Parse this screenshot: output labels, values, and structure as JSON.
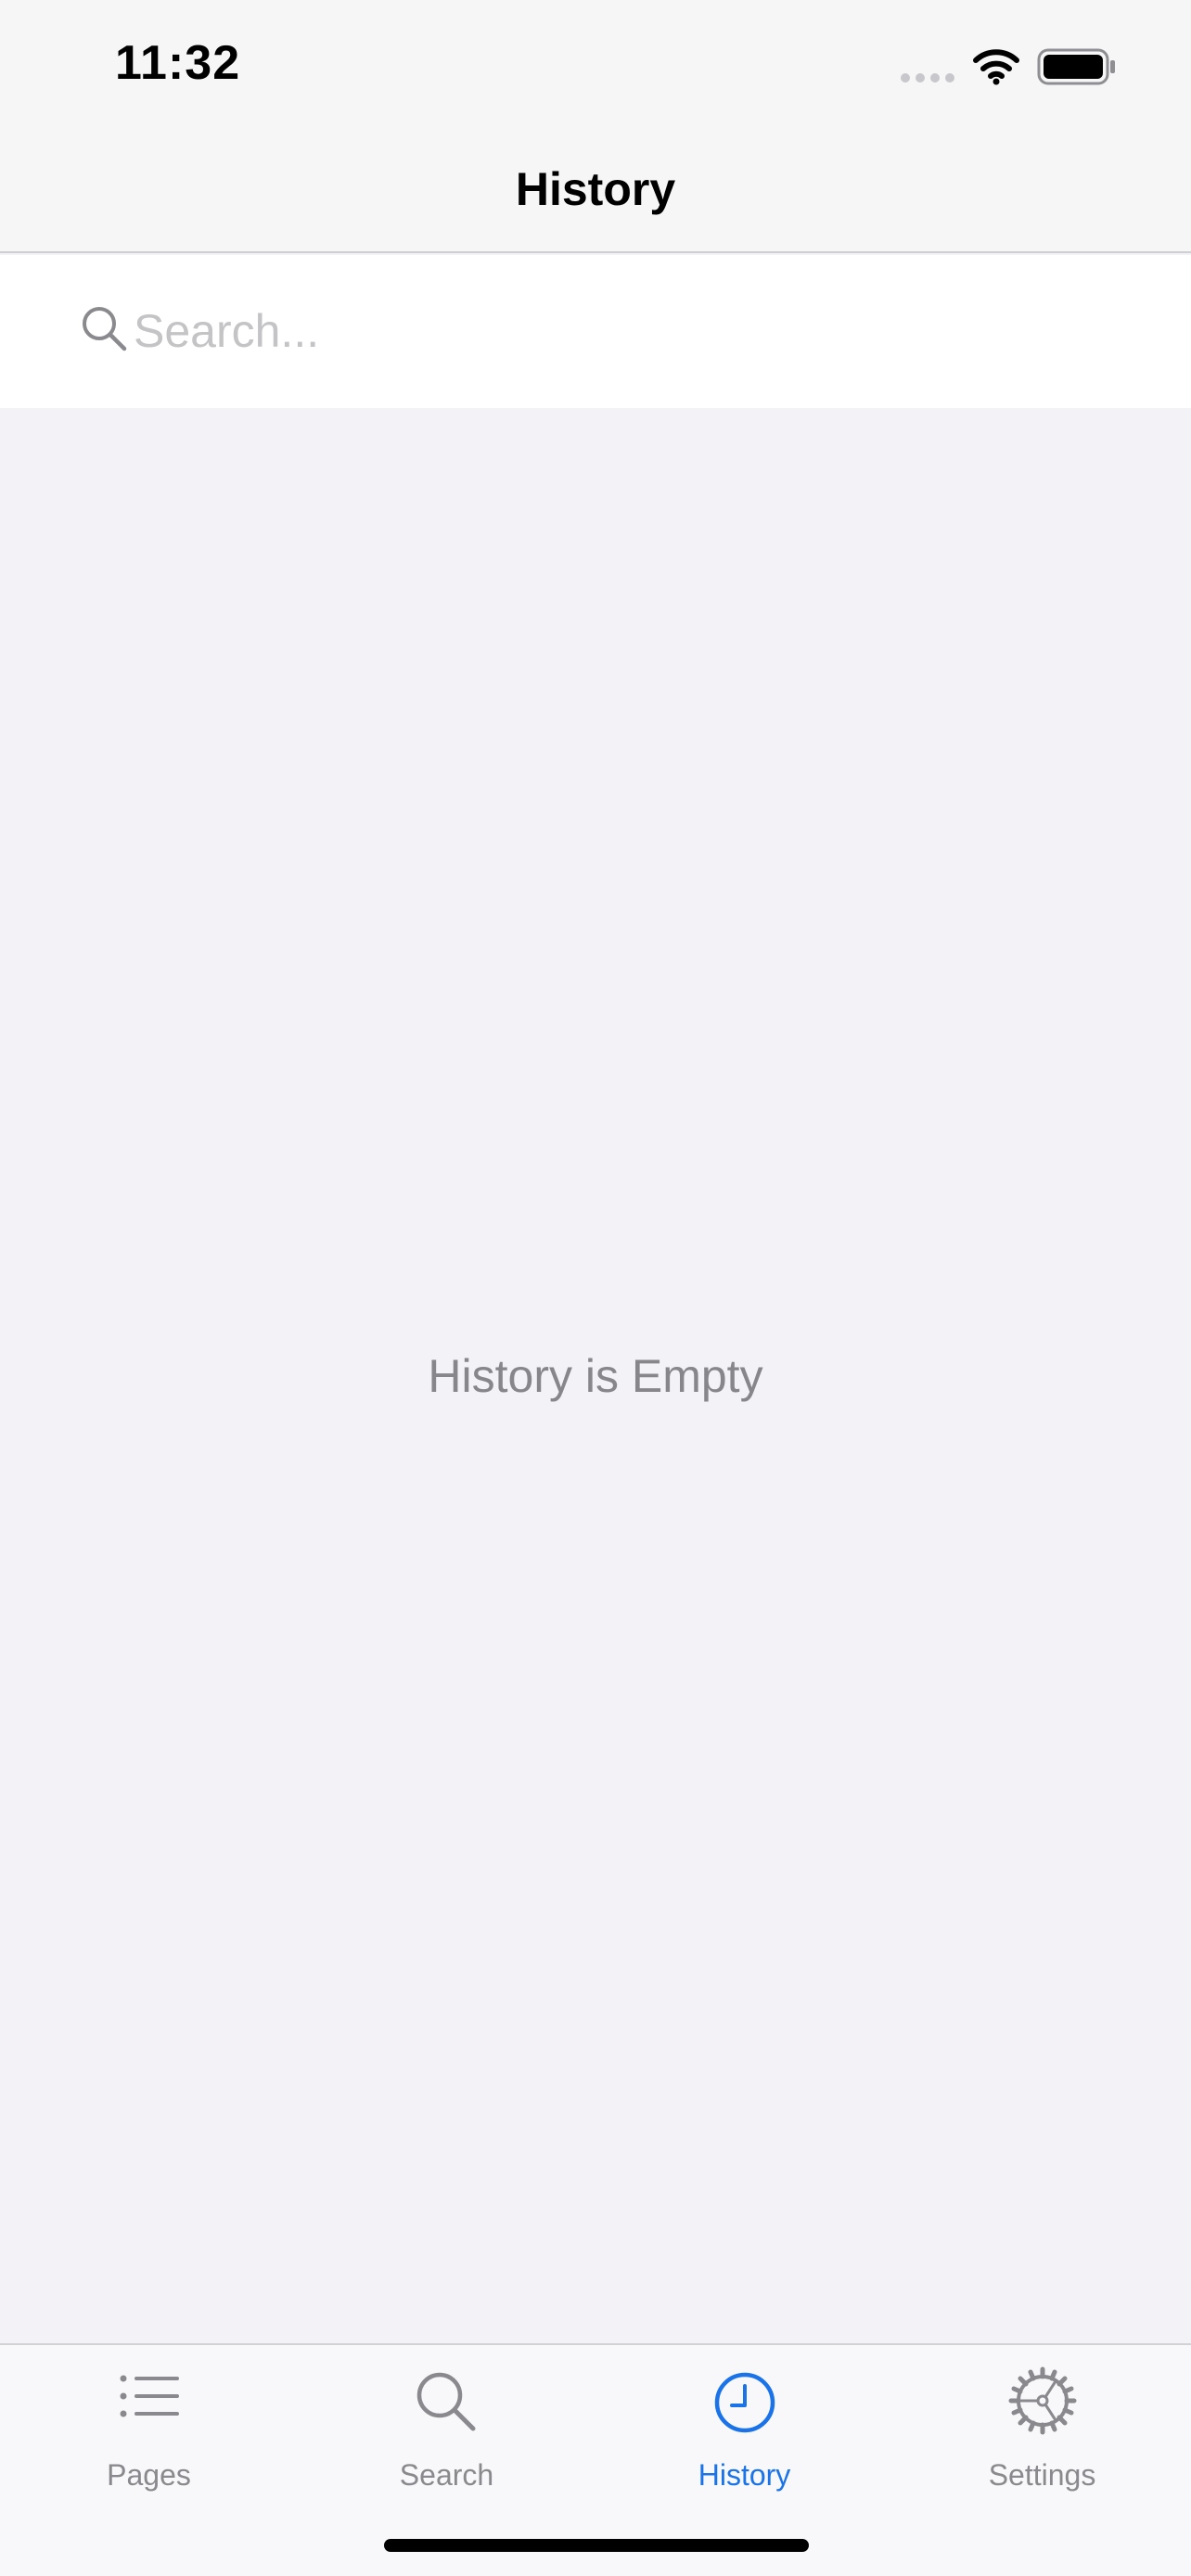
{
  "status_bar": {
    "time": "11:32",
    "signal_icon": "cellular-signal-icon",
    "wifi_icon": "wifi-icon",
    "battery_icon": "battery-icon"
  },
  "nav": {
    "title": "History"
  },
  "search": {
    "placeholder": "Search...",
    "value": "",
    "icon": "magnifier-icon"
  },
  "empty_state": {
    "message": "History is Empty"
  },
  "tab_bar": {
    "tabs": [
      {
        "label": "Pages",
        "icon": "list-icon",
        "active": false
      },
      {
        "label": "Search",
        "icon": "magnifier-icon",
        "active": false
      },
      {
        "label": "History",
        "icon": "clock-icon",
        "active": true
      },
      {
        "label": "Settings",
        "icon": "gear-icon",
        "active": false
      }
    ]
  },
  "colors": {
    "accent": "#1a73e8",
    "inactive": "#8a8a8e",
    "background": "#f2f2f7",
    "bar_background": "#f6f6f6"
  }
}
